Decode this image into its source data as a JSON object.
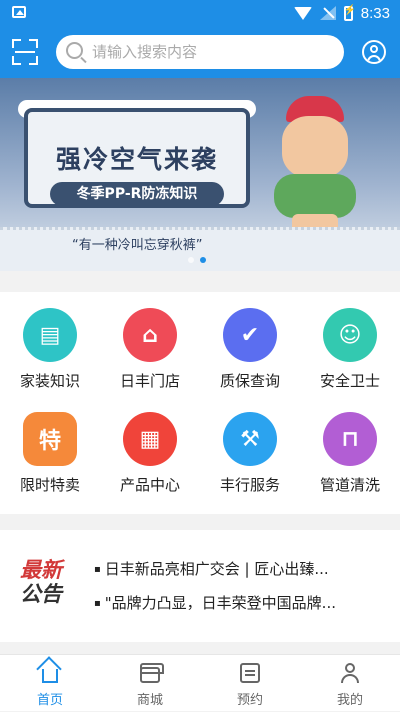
{
  "status_bar": {
    "time": "8:33"
  },
  "header": {
    "search_placeholder": "请输入搜索内容"
  },
  "banner": {
    "title": "强冷空气来袭",
    "subtitle": "冬季PP-R防冻知识",
    "caption": "“有一种冷叫忘穿秋裤”",
    "slide_count": 2,
    "active_slide": 2
  },
  "services": [
    {
      "label": "家装知识",
      "icon": "document-icon",
      "color": "#2ec4c6",
      "glyph": "▤"
    },
    {
      "label": "日丰门店",
      "icon": "store-icon",
      "color": "#ef4b57",
      "glyph": "⌂"
    },
    {
      "label": "质保查询",
      "icon": "shield-check-icon",
      "color": "#5b6ef0",
      "glyph": "✔"
    },
    {
      "label": "安全卫士",
      "icon": "guard-icon",
      "color": "#33c9b0",
      "glyph": "☺"
    },
    {
      "label": "限时特卖",
      "icon": "sale-tag-icon",
      "color": "#f5893a",
      "glyph": "特"
    },
    {
      "label": "产品中心",
      "icon": "grid-icon",
      "color": "#f0443a",
      "glyph": "▦"
    },
    {
      "label": "丰行服务",
      "icon": "drill-icon",
      "color": "#2ba3ef",
      "glyph": "⚒"
    },
    {
      "label": "管道清洗",
      "icon": "pipe-icon",
      "color": "#b25ed4",
      "glyph": "⊓"
    }
  ],
  "notice": {
    "logo_line1": "最新",
    "logo_line2": "公告",
    "items": [
      "日丰新品亮相广交会 | 匠心出臻...",
      "\"品牌力凸显，日丰荣登中国品牌..."
    ]
  },
  "tabbar": [
    {
      "label": "首页",
      "icon": "home-icon",
      "active": true
    },
    {
      "label": "商城",
      "icon": "store-icon",
      "active": false
    },
    {
      "label": "预约",
      "icon": "calendar-icon",
      "active": false
    },
    {
      "label": "我的",
      "icon": "user-icon",
      "active": false
    }
  ],
  "colors": {
    "primary": "#1e8ee6",
    "background": "#f2f2f2"
  }
}
